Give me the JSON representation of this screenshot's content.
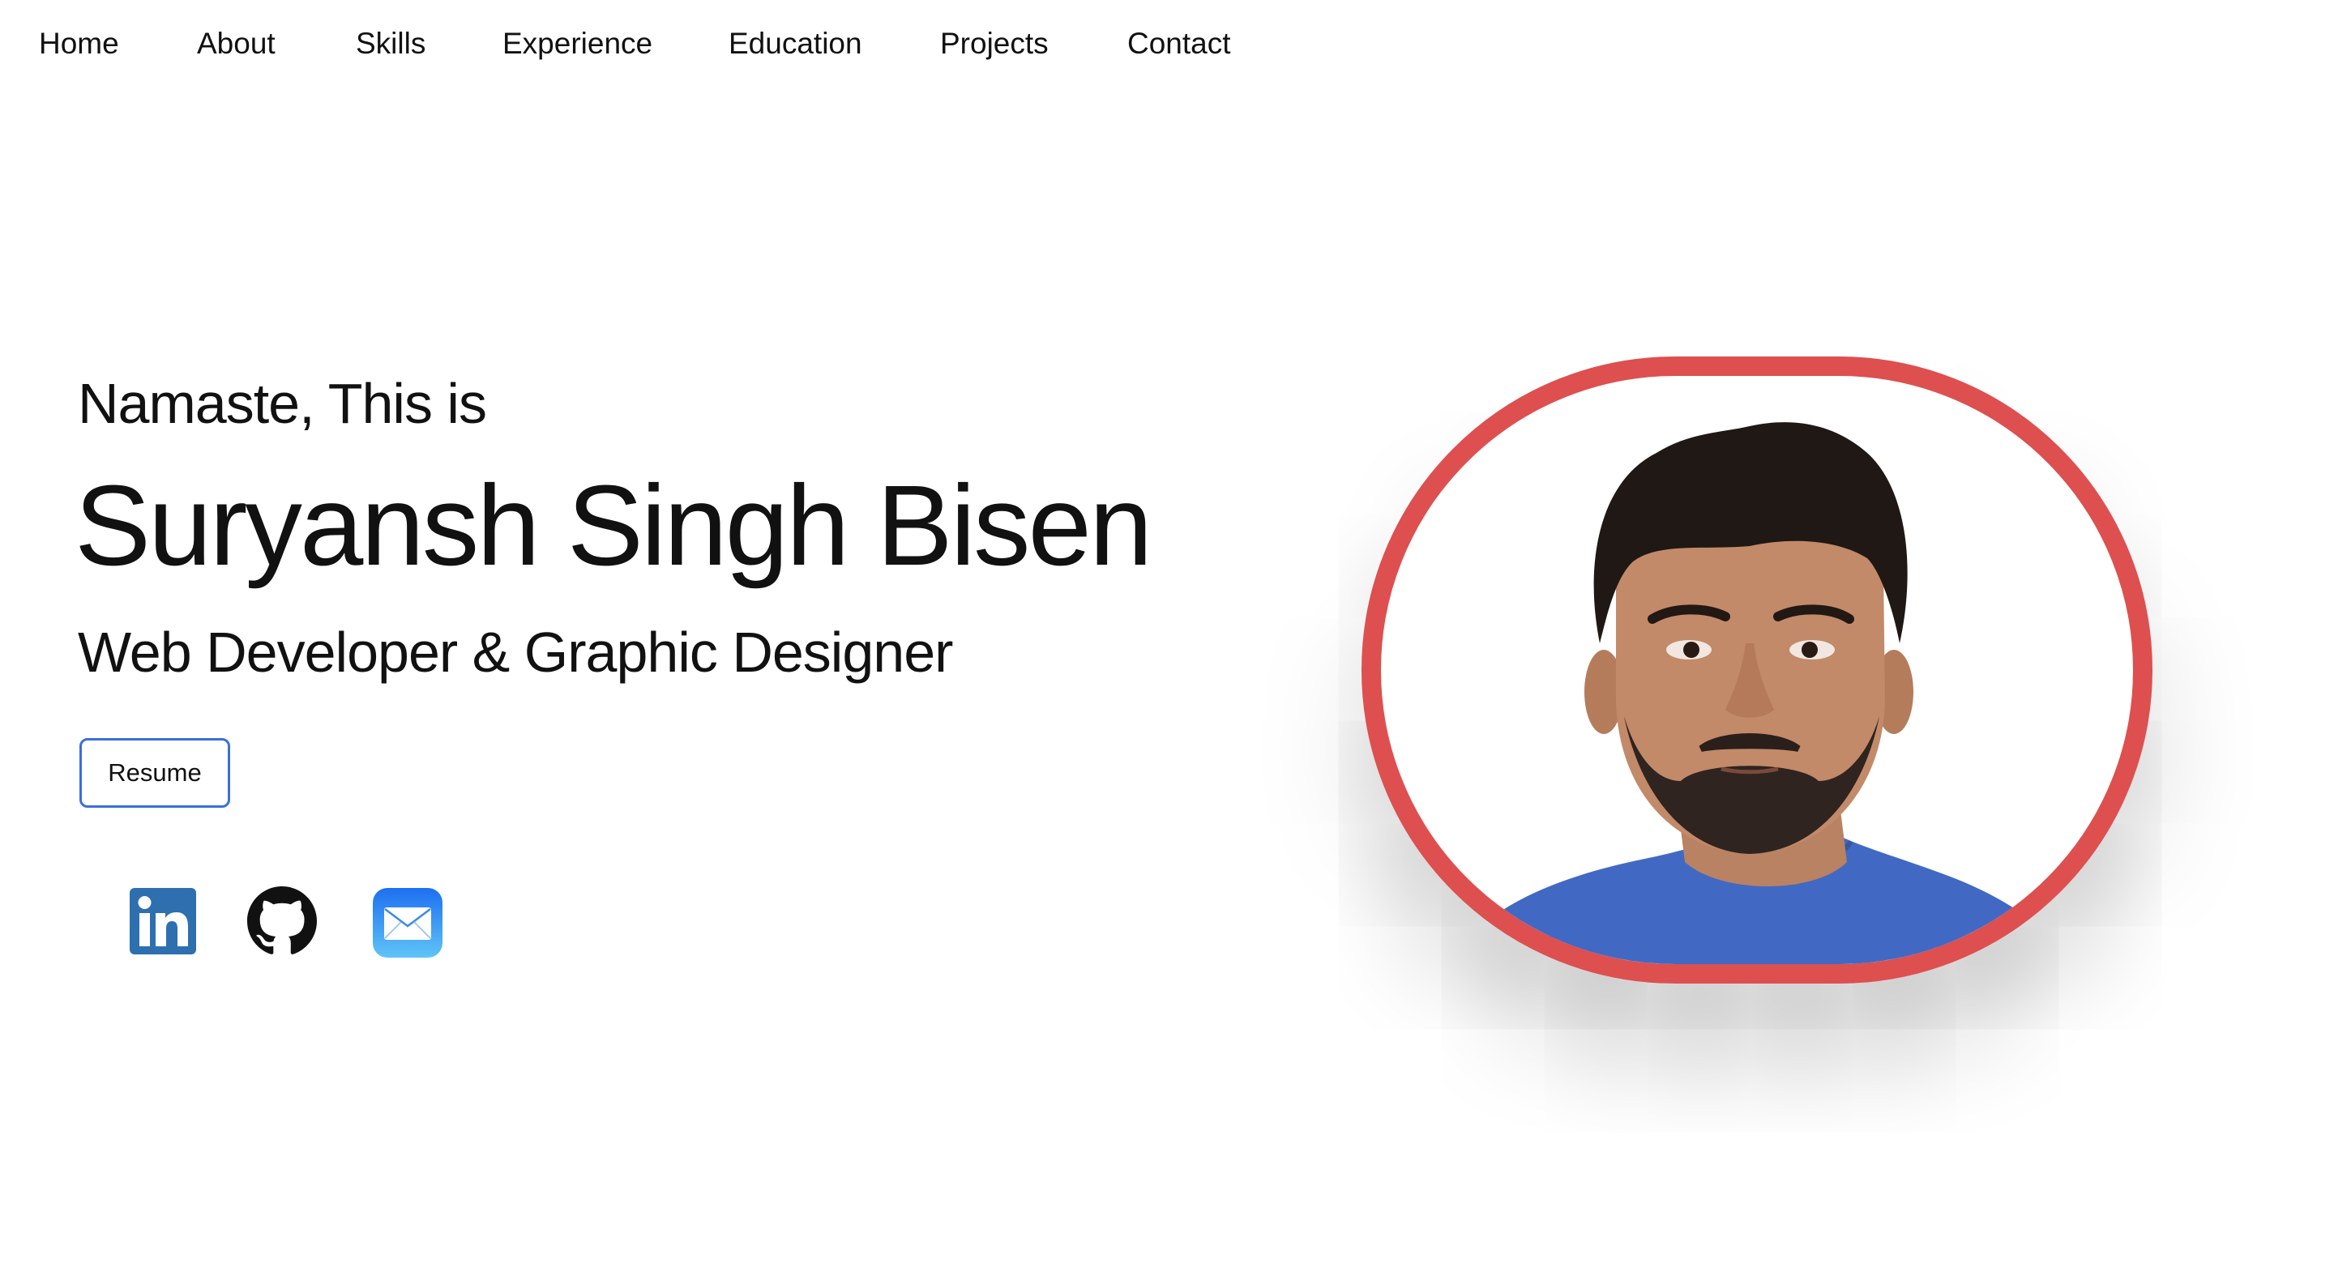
{
  "nav": {
    "items": [
      {
        "label": "Home"
      },
      {
        "label": "About"
      },
      {
        "label": "Skills"
      },
      {
        "label": "Experience"
      },
      {
        "label": "Education"
      },
      {
        "label": "Projects"
      },
      {
        "label": "Contact"
      }
    ]
  },
  "hero": {
    "greeting": "Namaste, This is",
    "name": "Suryansh Singh Bisen",
    "role": "Web Developer & Graphic Designer",
    "resume_label": "Resume"
  },
  "social": {
    "icons": [
      "linkedin-icon",
      "github-icon",
      "mail-icon"
    ]
  },
  "colors": {
    "frame_border": "#de4f4f",
    "button_border": "#3b6fdc",
    "linkedin": "#2e6fb0",
    "mail_top": "#1e6ff0",
    "mail_bottom": "#5fc4f7",
    "shirt": "#4169c4"
  }
}
